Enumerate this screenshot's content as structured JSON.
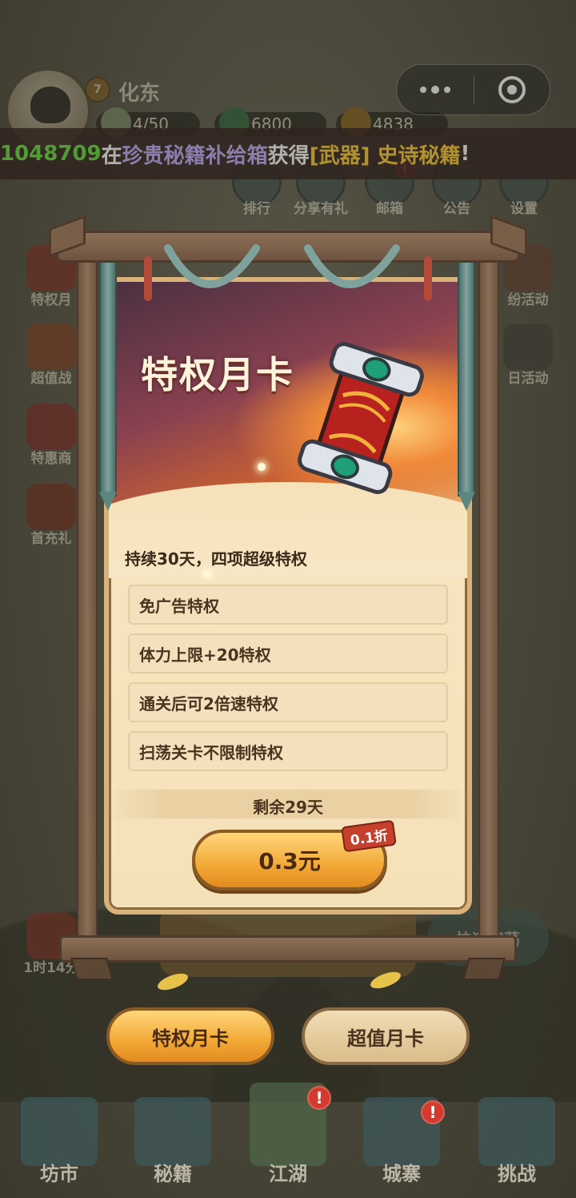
{
  "player": {
    "level": "7",
    "name": "化东",
    "stamina": "4/50",
    "jade": "6800",
    "coins": "4838"
  },
  "marquee": {
    "uid": "1048709",
    "word_at": "在",
    "box": "珍贵秘籍补给箱",
    "word_got": "获得",
    "item": "[武器] 史诗秘籍",
    "end": "!"
  },
  "top_icons": [
    {
      "label": "排行",
      "icon": "ranking-icon"
    },
    {
      "label": "分享有礼",
      "icon": "share-gift-icon"
    },
    {
      "label": "邮箱",
      "icon": "mail-icon",
      "badge": "!"
    },
    {
      "label": "公告",
      "icon": "notice-icon"
    },
    {
      "label": "设置",
      "icon": "gear-icon"
    }
  ],
  "left_icons": [
    {
      "label": "特权月",
      "icon": "privilege-card-icon"
    },
    {
      "label": "超值战",
      "icon": "battle-pass-icon"
    },
    {
      "label": "特惠商",
      "icon": "discount-shop-icon"
    },
    {
      "label": "首充礼",
      "icon": "first-recharge-icon"
    },
    {
      "label": "1时14分",
      "icon": "timed-gift-icon"
    }
  ],
  "right_icons": [
    {
      "label": "纷活动",
      "icon": "event-icon"
    },
    {
      "label": "日活动",
      "icon": "daily-event-icon"
    }
  ],
  "modal": {
    "title": "特权月卡",
    "subtitle": "持续30天，四项超级特权",
    "privileges": [
      "免广告特权",
      "体力上限+20特权",
      "通关后可2倍速特权",
      "扫荡关卡不限制特权"
    ],
    "remaining": "剩余29天",
    "price": "0.3元",
    "discount": "0.1折"
  },
  "background_buttons": {
    "quick_sweep": "快速扫荡"
  },
  "tabs": [
    {
      "label": "特权月卡",
      "active": true
    },
    {
      "label": "超值月卡",
      "active": false
    }
  ],
  "bottom_nav": [
    {
      "label": "坊市",
      "icon": "market-icon"
    },
    {
      "label": "秘籍",
      "icon": "book-icon"
    },
    {
      "label": "江湖",
      "icon": "mountain-icon",
      "badge": "!"
    },
    {
      "label": "城寨",
      "icon": "fortress-icon",
      "badge": "!"
    },
    {
      "label": "挑战",
      "icon": "swords-icon"
    }
  ],
  "colors": {
    "accent_orange": "#f2a936",
    "marquee_uid": "#6fe04b",
    "marquee_box": "#c7b2ff",
    "marquee_item": "#ffd23f",
    "badge_red": "#d23b2d"
  }
}
